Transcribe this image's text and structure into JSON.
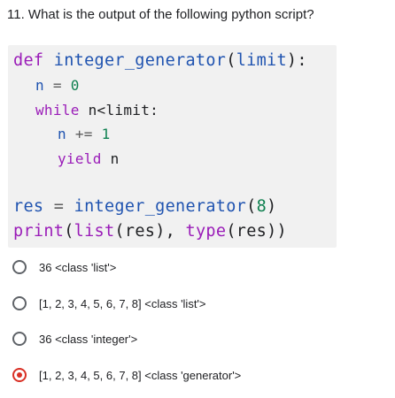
{
  "question": "11. What is the output of the following python script?",
  "code": {
    "l1": {
      "kw": "def",
      "fn": "integer_generator",
      "open": "(",
      "param": "limit",
      "close": "):"
    },
    "l2": {
      "var": "n",
      "eq": " = ",
      "val": "0"
    },
    "l3": {
      "kw": "while",
      "rest": " n<limit:"
    },
    "l4": {
      "var": "n",
      "op": " += ",
      "val": "1"
    },
    "l5": {
      "kw": "yield",
      "rest": " n"
    },
    "l6": {
      "var": "res",
      "eq": " = ",
      "fn": "integer_generator",
      "open": "(",
      "val": "8",
      "close": ")"
    },
    "l7": {
      "print": "print",
      "p1": "(",
      "list": "list",
      "p2": "(",
      "arg1": "res",
      "p3": "),",
      "sp": " ",
      "type": "type",
      "p4": "(",
      "arg2": "res",
      "p5": "))"
    }
  },
  "options": [
    {
      "label": "36 <class 'list'>",
      "selected": false
    },
    {
      "label": "[1, 2, 3, 4, 5, 6, 7, 8] <class 'list'>",
      "selected": false
    },
    {
      "label": "36 <class 'integer'>",
      "selected": false
    },
    {
      "label": "[1, 2, 3, 4, 5, 6, 7, 8] <class 'generator'>",
      "selected": true
    }
  ],
  "colors": {
    "selected": "#d93025",
    "radio": "#5f6368"
  }
}
